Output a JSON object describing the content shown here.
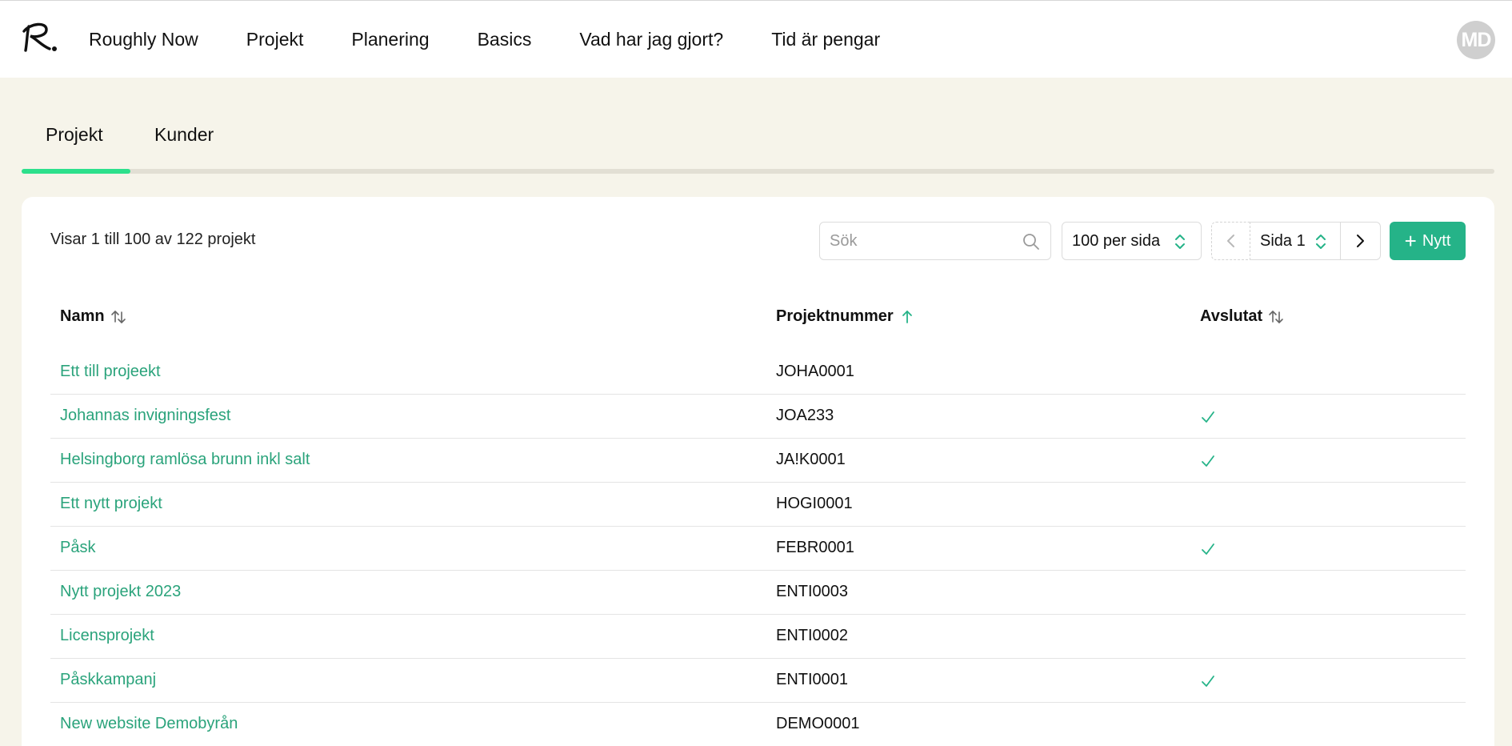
{
  "nav": {
    "items": [
      "Roughly Now",
      "Projekt",
      "Planering",
      "Basics",
      "Vad har jag gjort?",
      "Tid är pengar"
    ],
    "avatar_initials": "MD"
  },
  "tabs": [
    "Projekt",
    "Kunder"
  ],
  "toolbar": {
    "count_text": "Visar 1 till 100 av 122 projekt",
    "search_placeholder": "Sök",
    "per_page": "100 per sida",
    "page": "Sida 1",
    "new_label": "Nytt"
  },
  "table": {
    "headers": [
      "Namn",
      "Projektnummer",
      "Avslutat"
    ],
    "sorted_column": "Projektnummer",
    "rows": [
      {
        "name": "Ett till projeekt",
        "number": "JOHA0001",
        "done": false
      },
      {
        "name": "Johannas invigningsfest",
        "number": "JOA233",
        "done": true
      },
      {
        "name": "Helsingborg ramlösa brunn inkl salt",
        "number": "JA!K0001",
        "done": true
      },
      {
        "name": "Ett nytt projekt",
        "number": "HOGI0001",
        "done": false
      },
      {
        "name": "Påsk",
        "number": "FEBR0001",
        "done": true
      },
      {
        "name": "Nytt projekt 2023",
        "number": "ENTI0003",
        "done": false
      },
      {
        "name": "Licensprojekt",
        "number": "ENTI0002",
        "done": false
      },
      {
        "name": "Påskkampanj",
        "number": "ENTI0001",
        "done": true
      },
      {
        "name": "New website Demobyrån",
        "number": "DEMO0001",
        "done": false
      }
    ]
  },
  "colors": {
    "accent": "#25b388",
    "link": "#2aa37b",
    "tab_indicator": "#2de08c",
    "background": "#f6f4ea"
  }
}
